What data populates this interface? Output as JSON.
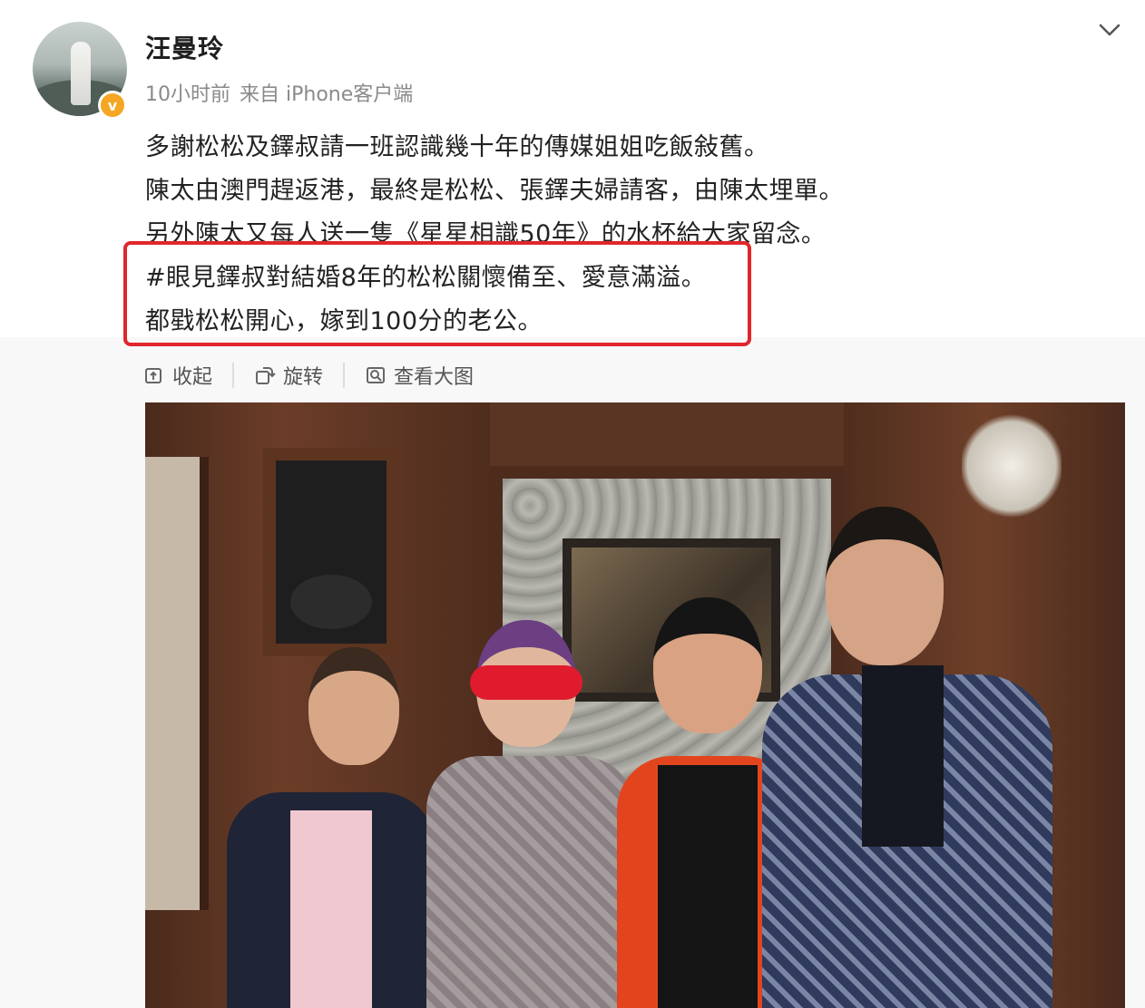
{
  "post": {
    "username": "汪曼玲",
    "time": "10小时前",
    "source": "来自 iPhone客户端",
    "lines": [
      "多謝松松及鐸叔請一班認識幾十年的傳媒姐姐吃飯敍舊。",
      "陳太由澳門趕返港，最終是松松、張鐸夫婦請客，由陳太埋單。",
      "另外陳太又每人送一隻《星星相識50年》的水杯給大家留念。",
      "#眼見鐸叔對結婚8年的松松關懷備至、愛意滿溢。",
      "都戥松松開心，嫁到100分的老公。"
    ]
  },
  "actions": {
    "collect": "收起",
    "rotate": "旋转",
    "view_large": "查看大图"
  },
  "colors": {
    "highlight": "#e0262c",
    "verified": "#f5a623",
    "meta_text": "#8a8a8a"
  },
  "icons": [
    "verified-badge-icon",
    "chevron-down-icon",
    "collapse-icon",
    "rotate-icon",
    "view-large-icon"
  ]
}
